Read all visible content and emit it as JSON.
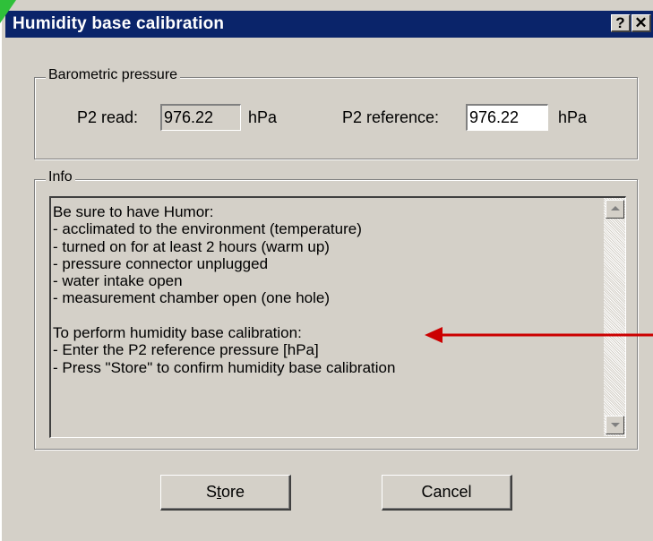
{
  "window": {
    "title": "Humidity base calibration",
    "help_label": "?",
    "close_label": "✕"
  },
  "barometric": {
    "legend": "Barometric pressure",
    "p2_read_label": "P2 read:",
    "p2_read_value": "976.22",
    "p2_read_unit": "hPa",
    "p2_ref_label": "P2 reference:",
    "p2_ref_value": "976.22",
    "p2_ref_unit": "hPa"
  },
  "info": {
    "legend": "Info",
    "lines": [
      "Be sure to have Humor:",
      "- acclimated to the environment (temperature)",
      "- turned on for at least 2 hours (warm up)",
      "- pressure connector unplugged",
      "- water intake open",
      "- measurement chamber open (one hole)",
      "",
      "To perform humidity base calibration:",
      "- Enter the P2 reference pressure [hPa]",
      "- Press \"Store\" to confirm humidity base calibration"
    ]
  },
  "buttons": {
    "store_prefix": "S",
    "store_underlined": "t",
    "store_suffix": "ore",
    "cancel": "Cancel"
  },
  "colors": {
    "titlebar": "#0a246a",
    "face": "#d4d0c8",
    "annotation_arrow": "#cc0000",
    "corner_mark": "#2fc03a"
  }
}
